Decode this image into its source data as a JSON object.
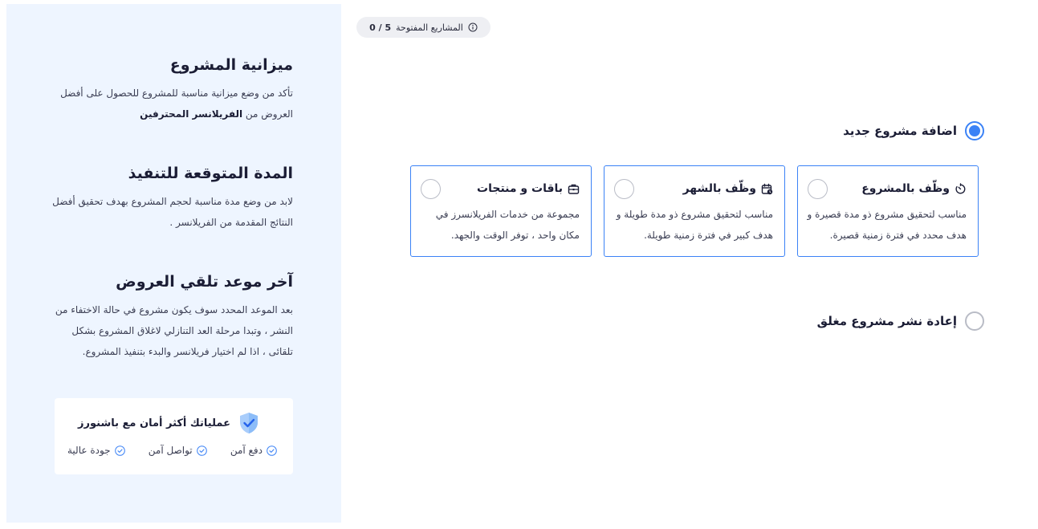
{
  "side_panel": {
    "budget": {
      "title": "ميزانية المشروع",
      "text": "تأكد من وضع ميزانية مناسبة للمشروع للحصول على أفضل العروض من",
      "bold": "الفريلانسر المحترفين"
    },
    "duration": {
      "title": "المدة المتوقعة للتنفيذ",
      "text": "لابد من وضع مدة مناسبة لحجم المشروع بهدف تحقيق أفضل النتائج المقدمة من الفريلانسر ."
    },
    "deadline": {
      "title": "آخر موعد تلقي العروض",
      "text": "بعد الموعد المحدد سوف يكون مشروع في حالة الاختفاء من النشر ، وتبدا مرحلة العد التنازلي لاغلاق المشروع بشكل تلقائى ، اذا لم اختيار فريلانسر والبدء بتنفيذ المشروع."
    },
    "security": {
      "title": "عملياتك أكثر أمان مع باشنورز",
      "features": [
        "دفع آمن",
        "تواصل آمن",
        "جودة عالية"
      ]
    }
  },
  "main": {
    "counter": {
      "label": "المشاريع المفتوحة",
      "value": "0 / 5"
    },
    "new_project_label": "اضافة مشروع جديد",
    "republish_label": "إعادة نشر مشروع مغلق",
    "cards": [
      {
        "title": "وظّف بالمشروع",
        "desc": "مناسب لتحقيق مشروع ذو مدة قصيرة و هدف محدد في فترة زمنية قصيرة."
      },
      {
        "title": "وظّف بالشهر",
        "desc": "مناسب لتحقيق مشروع ذو مدة طويلة و هدف كبير في فترة زمنية طويلة."
      },
      {
        "title": "باقات و منتجات",
        "desc": "مجموعة من خدمات الفريلانسرز في مكان واحد ، توفر الوقت والجهد."
      }
    ]
  },
  "colors": {
    "accent": "#3b82f6",
    "panel_bg": "#eef5ff",
    "pill_bg": "#eeeff3"
  },
  "icons": {
    "counter": "info-icon",
    "card_1": "timer-icon",
    "card_2": "calendar-clock-icon",
    "card_3": "briefcase-icon",
    "security": "shield-check-icon",
    "feature": "check-circle-icon"
  }
}
